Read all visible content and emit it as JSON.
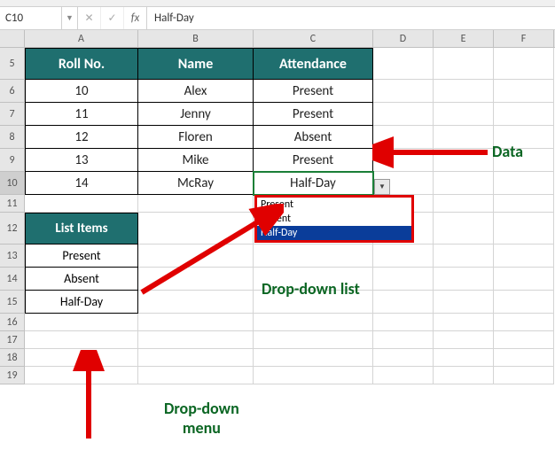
{
  "name_box": "C10",
  "formula_value": "Half-Day",
  "columns": [
    "A",
    "B",
    "C",
    "D",
    "E",
    "F"
  ],
  "visible_rows": [
    "5",
    "6",
    "7",
    "8",
    "9",
    "10",
    "11",
    "12",
    "13",
    "14",
    "15",
    "16",
    "17",
    "18",
    "19"
  ],
  "table": {
    "headers": [
      "Roll No.",
      "Name",
      "Attendance"
    ],
    "rows": [
      [
        "10",
        "Alex",
        "Present"
      ],
      [
        "11",
        "Jenny",
        "Present"
      ],
      [
        "12",
        "Floren",
        "Absent"
      ],
      [
        "13",
        "Mike",
        "Present"
      ],
      [
        "14",
        "McRay",
        "Half-Day"
      ]
    ]
  },
  "list_items": {
    "header": "List Items",
    "items": [
      "Present",
      "Absent",
      "Half-Day"
    ]
  },
  "dropdown": {
    "options": [
      "Present",
      "Absent",
      "Half-Day"
    ],
    "selected_index": 2
  },
  "annotations": {
    "data": "Data",
    "dd_list": "Drop-down list",
    "dd_menu": "Drop-down\nmenu"
  }
}
